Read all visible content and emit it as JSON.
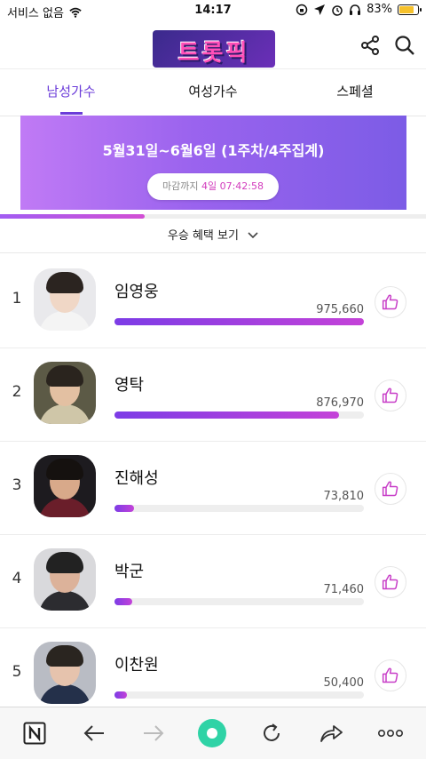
{
  "status_bar": {
    "carrier": "서비스 없음",
    "time": "14:17",
    "battery": "83%",
    "battery_level": 0.83
  },
  "header": {
    "logo_text": "트롯픽",
    "share_icon": "share-icon",
    "search_icon": "search-icon"
  },
  "tabs": [
    {
      "label": "남성가수",
      "active": true
    },
    {
      "label": "여성가수",
      "active": false
    },
    {
      "label": "스페셜",
      "active": false
    }
  ],
  "banner": {
    "title": "5월31일~6월6일 (1주차/4주집계)",
    "deadline_label": "마감까지",
    "deadline_value": "4일 07:42:58"
  },
  "progress_fraction": 0.34,
  "benefit_link": "우승 혜택 보기",
  "ranking": [
    {
      "rank": "1",
      "name": "임영웅",
      "votes": "975,660",
      "bar_fraction": 1.0
    },
    {
      "rank": "2",
      "name": "영탁",
      "votes": "876,970",
      "bar_fraction": 0.9
    },
    {
      "rank": "3",
      "name": "진해성",
      "votes": "73,810",
      "bar_fraction": 0.08
    },
    {
      "rank": "4",
      "name": "박군",
      "votes": "71,460",
      "bar_fraction": 0.07
    },
    {
      "rank": "5",
      "name": "이찬원",
      "votes": "50,400",
      "bar_fraction": 0.05
    }
  ],
  "colors": {
    "accent": "#6b3cd9",
    "like_icon": "#c83fc8",
    "bar_start": "#7c3ce6",
    "bar_end": "#c442d8"
  },
  "bottom_bar": {
    "icons": [
      "naver-n-icon",
      "back-arrow-icon",
      "forward-arrow-icon",
      "home-green-icon",
      "refresh-icon",
      "share-arrow-icon",
      "more-icon"
    ]
  }
}
